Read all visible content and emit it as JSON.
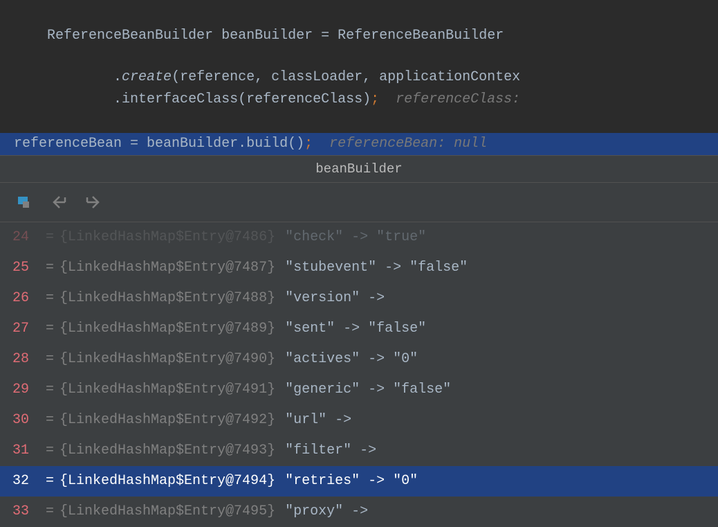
{
  "code": {
    "line1": {
      "type1": "ReferenceBeanBuilder",
      "var": "beanBuilder",
      "eq": "=",
      "type2": "ReferenceBeanBuilder"
    },
    "line2": {
      "indent": "            ",
      "dot": ".",
      "method": "create",
      "args": "(reference, classLoader, applicationContex"
    },
    "line3": {
      "indent": "            ",
      "dot": ".",
      "method": "interfaceClass",
      "args": "(referenceClass)",
      "semi": ";",
      "hint": "  referenceClass:"
    },
    "line4": {
      "var": "referenceBean",
      "eq": " = ",
      "builder": "beanBuilder",
      "dot": ".",
      "method": "build",
      "args": "()",
      "semi": ";",
      "hint": "  referenceBean: null"
    }
  },
  "debugger": {
    "title": "beanBuilder",
    "entries": [
      {
        "index": "24",
        "class": "{LinkedHashMap$Entry@7486}",
        "value": "\"check\" -> \"true\"",
        "faded": true
      },
      {
        "index": "25",
        "class": "{LinkedHashMap$Entry@7487}",
        "value": "\"stubevent\" -> \"false\""
      },
      {
        "index": "26",
        "class": "{LinkedHashMap$Entry@7488}",
        "value": "\"version\" -> "
      },
      {
        "index": "27",
        "class": "{LinkedHashMap$Entry@7489}",
        "value": "\"sent\" -> \"false\""
      },
      {
        "index": "28",
        "class": "{LinkedHashMap$Entry@7490}",
        "value": "\"actives\" -> \"0\""
      },
      {
        "index": "29",
        "class": "{LinkedHashMap$Entry@7491}",
        "value": "\"generic\" -> \"false\""
      },
      {
        "index": "30",
        "class": "{LinkedHashMap$Entry@7492}",
        "value": "\"url\" -> "
      },
      {
        "index": "31",
        "class": "{LinkedHashMap$Entry@7493}",
        "value": "\"filter\" -> "
      },
      {
        "index": "32",
        "class": "{LinkedHashMap$Entry@7494}",
        "value": "\"retries\" -> \"0\"",
        "selected": true
      },
      {
        "index": "33",
        "class": "{LinkedHashMap$Entry@7495}",
        "value": "\"proxy\" -> "
      }
    ]
  }
}
